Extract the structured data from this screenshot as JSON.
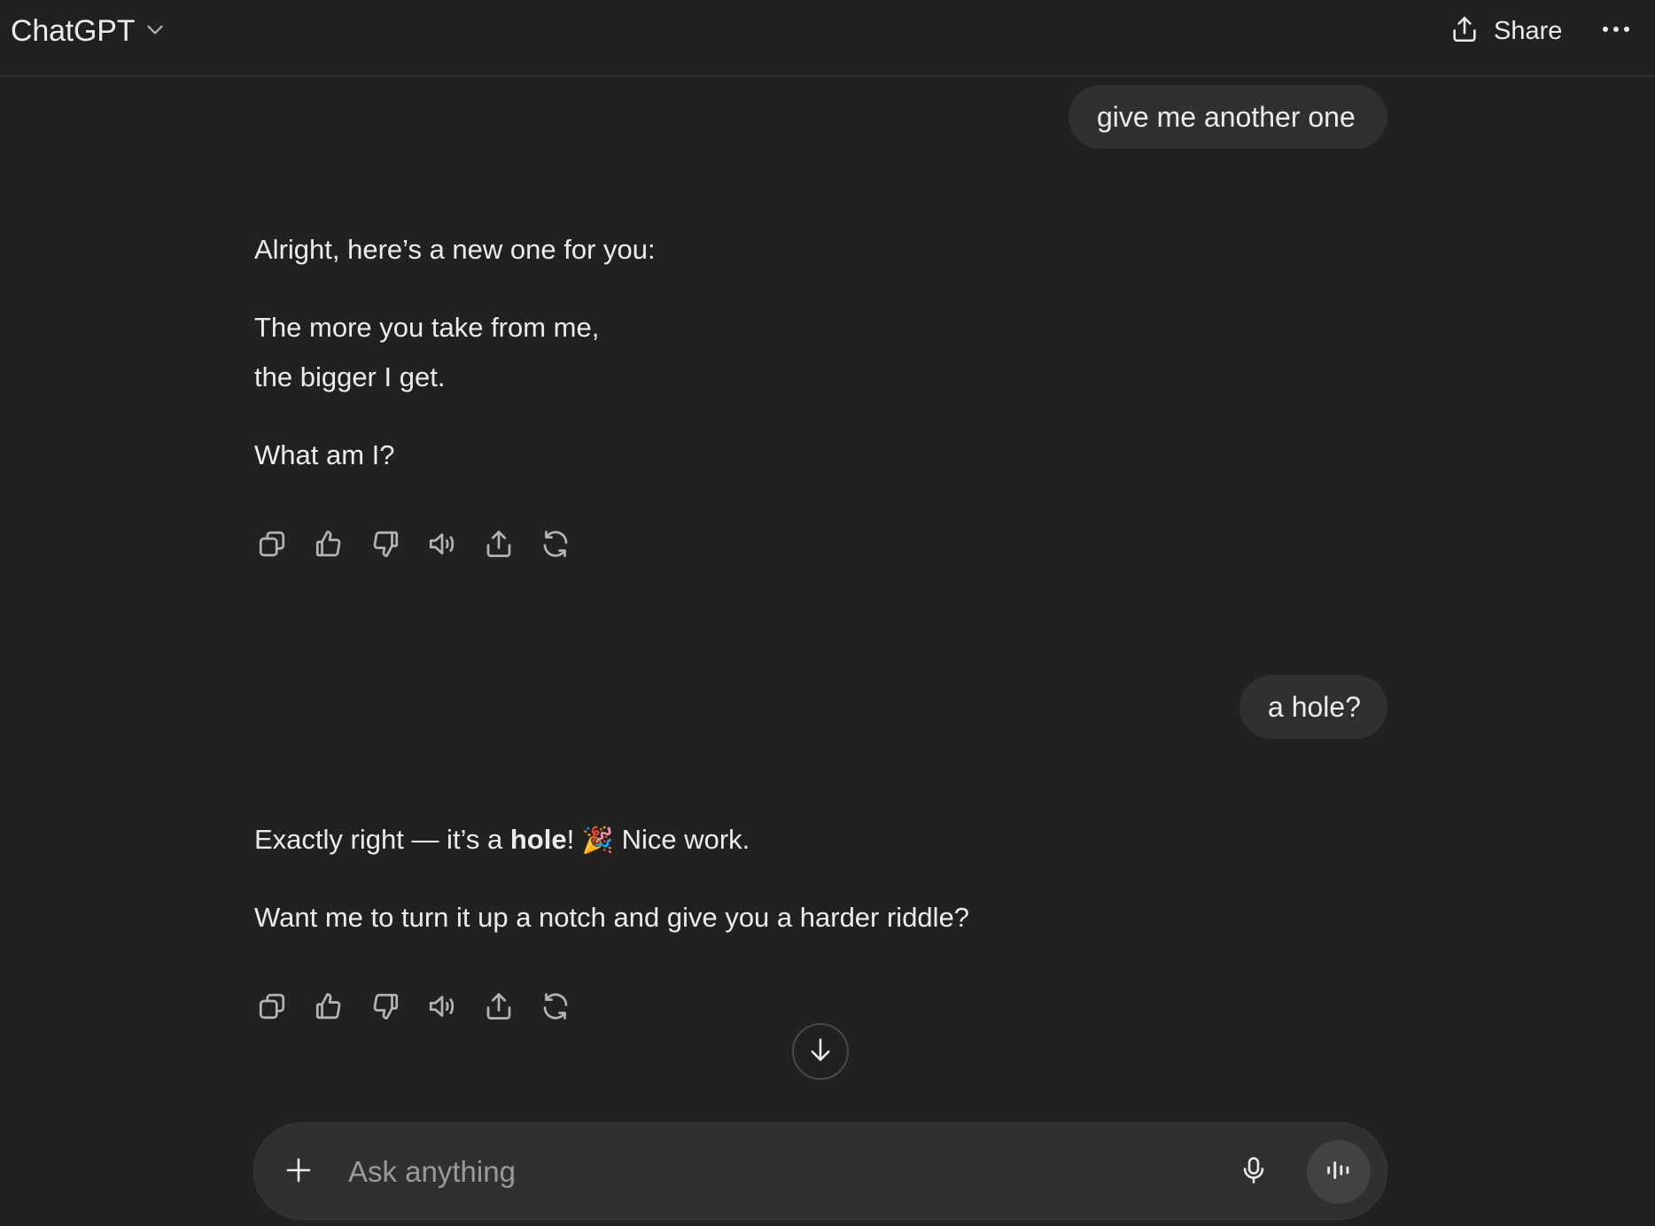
{
  "header": {
    "model_name": "ChatGPT",
    "share_label": "Share"
  },
  "messages": [
    {
      "role": "user",
      "text": "give me another one"
    },
    {
      "role": "assistant",
      "lines": [
        "Alright, here’s a new one for you:",
        "The more you take from me,",
        "the bigger I get.",
        "What am I?"
      ]
    },
    {
      "role": "user",
      "text": "a hole?"
    },
    {
      "role": "assistant",
      "line1_prefix": "Exactly right — it’s a ",
      "line1_bold": "hole",
      "line1_exclaim": "!",
      "line1_emoji": "🎉",
      "line1_suffix": "Nice work.",
      "line2": "Want me to turn it up a notch and give you a harder riddle?"
    }
  ],
  "message_actions": [
    "copy-icon",
    "thumbs-up-icon",
    "thumbs-down-icon",
    "speaker-icon",
    "share-icon",
    "regenerate-icon"
  ],
  "composer": {
    "placeholder": "Ask anything"
  },
  "colors": {
    "background": "#212121",
    "bubble": "#303030",
    "text": "#ececec",
    "placeholder": "#9a9a9a",
    "voice_button": "#424242"
  }
}
